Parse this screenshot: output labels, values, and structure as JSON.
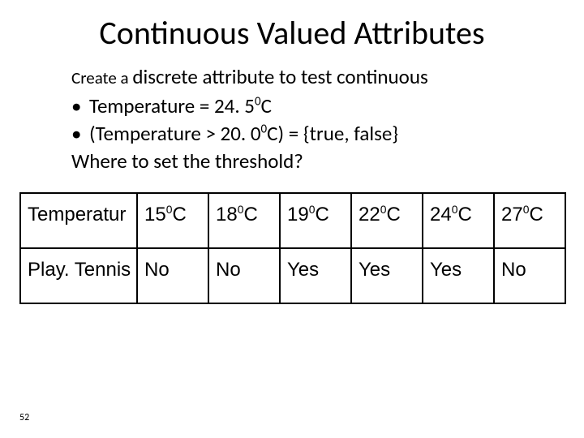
{
  "title": "Continuous Valued Attributes",
  "lead": {
    "prefix": "Create a ",
    "rest": "discrete attribute to test continuous"
  },
  "bullets": {
    "b1": {
      "pre": "Temperature = 24. 5",
      "deg": "0",
      "suf": "C"
    },
    "b2": {
      "pre": "(Temperature > 20. 0",
      "deg": "0",
      "suf": "C) = {true, false}"
    }
  },
  "where": "Where to set the threshold?",
  "table": {
    "row1": {
      "label": "Temperatur",
      "c1": {
        "n": "15",
        "d": "0",
        "u": "C"
      },
      "c2": {
        "n": "18",
        "d": "0",
        "u": "C"
      },
      "c3": {
        "n": "19",
        "d": "0",
        "u": "C"
      },
      "c4": {
        "n": "22",
        "d": "0",
        "u": "C"
      },
      "c5": {
        "n": "24",
        "d": "0",
        "u": "C"
      },
      "c6": {
        "n": "27",
        "d": "0",
        "u": "C"
      }
    },
    "row2": {
      "label": "Play. Tennis",
      "c1": "No",
      "c2": "No",
      "c3": "Yes",
      "c4": "Yes",
      "c5": "Yes",
      "c6": "No"
    }
  },
  "page": "52",
  "chart_data": {
    "type": "table",
    "title": "Continuous Valued Attributes",
    "columns": [
      "Temperatur",
      "15⁰C",
      "18⁰C",
      "19⁰C",
      "22⁰C",
      "24⁰C",
      "27⁰C"
    ],
    "rows": [
      [
        "Play. Tennis",
        "No",
        "No",
        "Yes",
        "Yes",
        "Yes",
        "No"
      ]
    ]
  }
}
